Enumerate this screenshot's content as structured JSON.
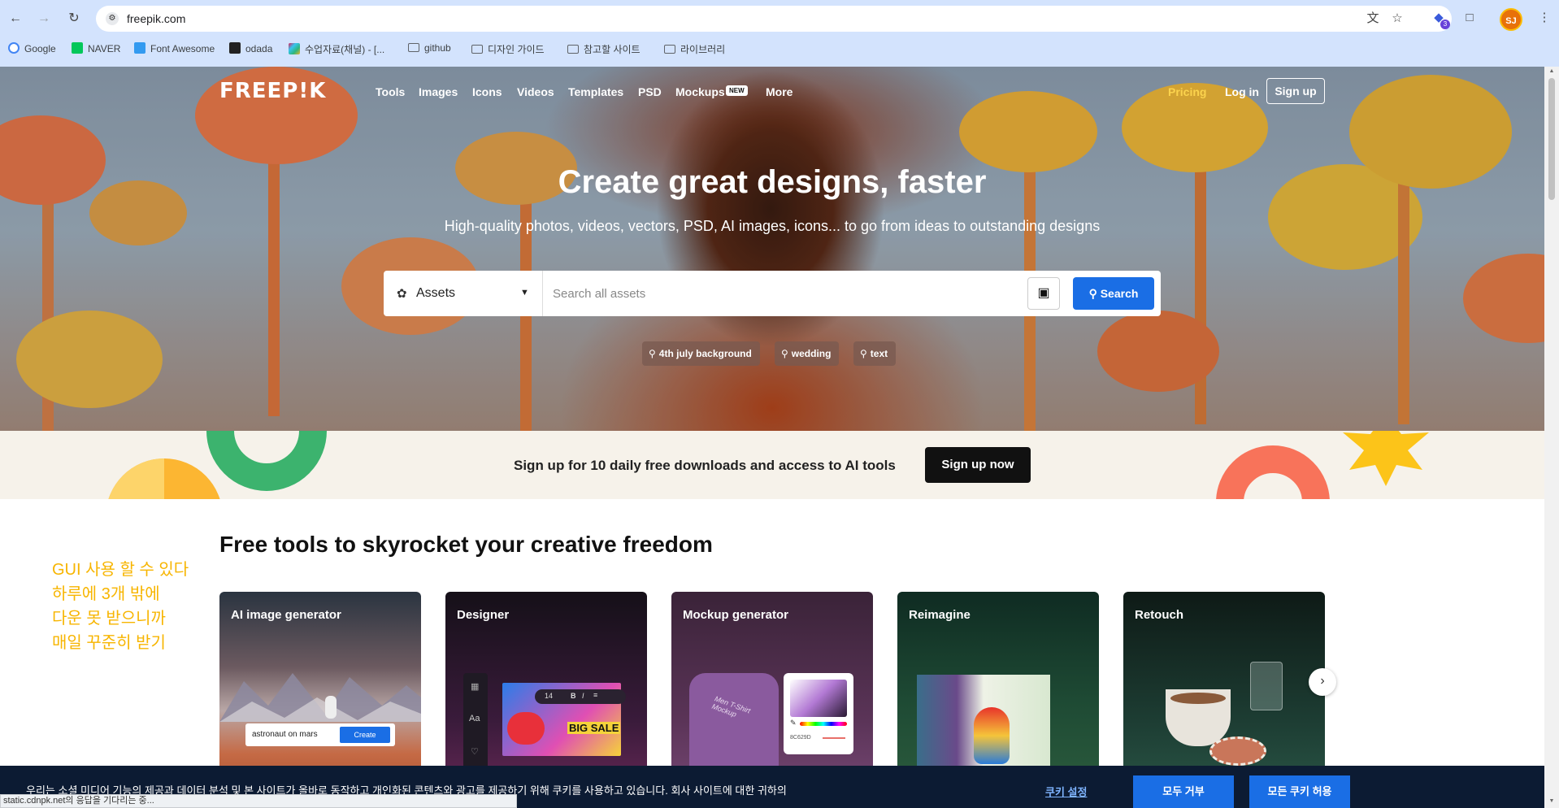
{
  "browser": {
    "url": "freepik.com",
    "profile_initials": "SJ",
    "extension_badge": "3",
    "bookmarks": [
      {
        "label": "Google"
      },
      {
        "label": "NAVER"
      },
      {
        "label": "Font Awesome"
      },
      {
        "label": "odada"
      },
      {
        "label": "수업자료(채널) - [..."
      },
      {
        "label": "github"
      },
      {
        "label": "디자인 가이드"
      },
      {
        "label": "참고할 사이트"
      },
      {
        "label": "라이브러리"
      }
    ]
  },
  "header": {
    "logo": "FREEP!K",
    "nav": [
      "Tools",
      "Images",
      "Icons",
      "Videos",
      "Templates",
      "PSD",
      "Mockups",
      "More"
    ],
    "new_badge": "NEW",
    "pricing": "Pricing",
    "login": "Log in",
    "signup": "Sign up"
  },
  "hero": {
    "title": "Create great designs, faster",
    "subtitle": "High-quality photos, videos, vectors, PSD, AI images, icons... to go from ideas to outstanding designs",
    "asset_type": "Assets",
    "search_placeholder": "Search all assets",
    "search_button": "Search",
    "suggestions": [
      "4th july background",
      "wedding",
      "text"
    ]
  },
  "banner": {
    "text": "Sign up for 10 daily free downloads and access to AI tools",
    "button": "Sign up now"
  },
  "tools": {
    "title": "Free tools to skyrocket your creative freedom",
    "cards": [
      {
        "title": "AI image generator",
        "prompt": "astronaut on mars",
        "create": "Create"
      },
      {
        "title": "Designer",
        "sale_text": "BIG SALE",
        "font_size": "14"
      },
      {
        "title": "Mockup generator",
        "mockup_text": "Men T-Shirt Mockup",
        "hex": "8C629D"
      },
      {
        "title": "Reimagine"
      },
      {
        "title": "Retouch"
      }
    ]
  },
  "note": {
    "lines": [
      "GUI 사용 할 수 있다",
      "하루에 3개 밖에",
      "다운 못 받으니까",
      "매일 꾸준히 받기"
    ]
  },
  "cookie": {
    "text": "우리는 소셜 미디어 기능의 제공과 데이터 분석 및 본 사이트가 올바로 동작하고 개인화된 콘텐츠와 광고를 제공하기 위해 쿠키를 사용하고 있습니다. 회사 사이트에 대한 귀하의",
    "settings": "쿠키 설정",
    "reject": "모두 거부",
    "accept": "모든 쿠키 허용"
  },
  "status": "static.cdnpk.net의 응답을 기다리는 중..."
}
